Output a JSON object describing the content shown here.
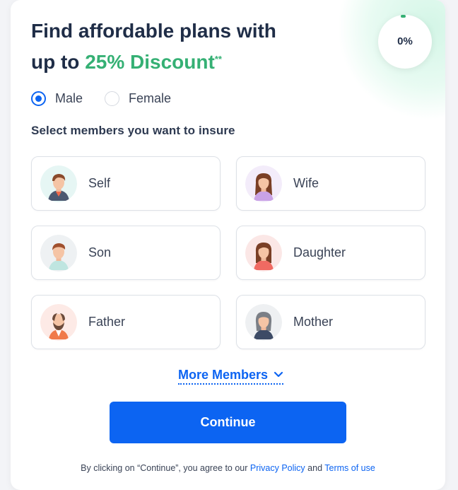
{
  "progress": {
    "value": 0,
    "label": "0%"
  },
  "headline": {
    "line1": "Find affordable plans with",
    "line2_prefix": "up to ",
    "line2_accent": "25% Discount",
    "footnote_mark": "**"
  },
  "gender": {
    "options": [
      {
        "label": "Male",
        "selected": true
      },
      {
        "label": "Female",
        "selected": false
      }
    ]
  },
  "members": {
    "title": "Select members you want to insure",
    "items": [
      {
        "label": "Self",
        "icon": "self-avatar-icon"
      },
      {
        "label": "Wife",
        "icon": "wife-avatar-icon"
      },
      {
        "label": "Son",
        "icon": "son-avatar-icon"
      },
      {
        "label": "Daughter",
        "icon": "daughter-avatar-icon"
      },
      {
        "label": "Father",
        "icon": "father-avatar-icon"
      },
      {
        "label": "Mother",
        "icon": "mother-avatar-icon"
      }
    ],
    "more_label": "More Members"
  },
  "actions": {
    "continue_label": "Continue"
  },
  "legal": {
    "prefix": "By clicking on “Continue”, you agree to our ",
    "privacy": "Privacy Policy",
    "and": " and ",
    "terms": "Terms of use"
  },
  "colors": {
    "primary": "#0c64f2",
    "accent": "#35b074",
    "heading": "#1f2d47"
  }
}
